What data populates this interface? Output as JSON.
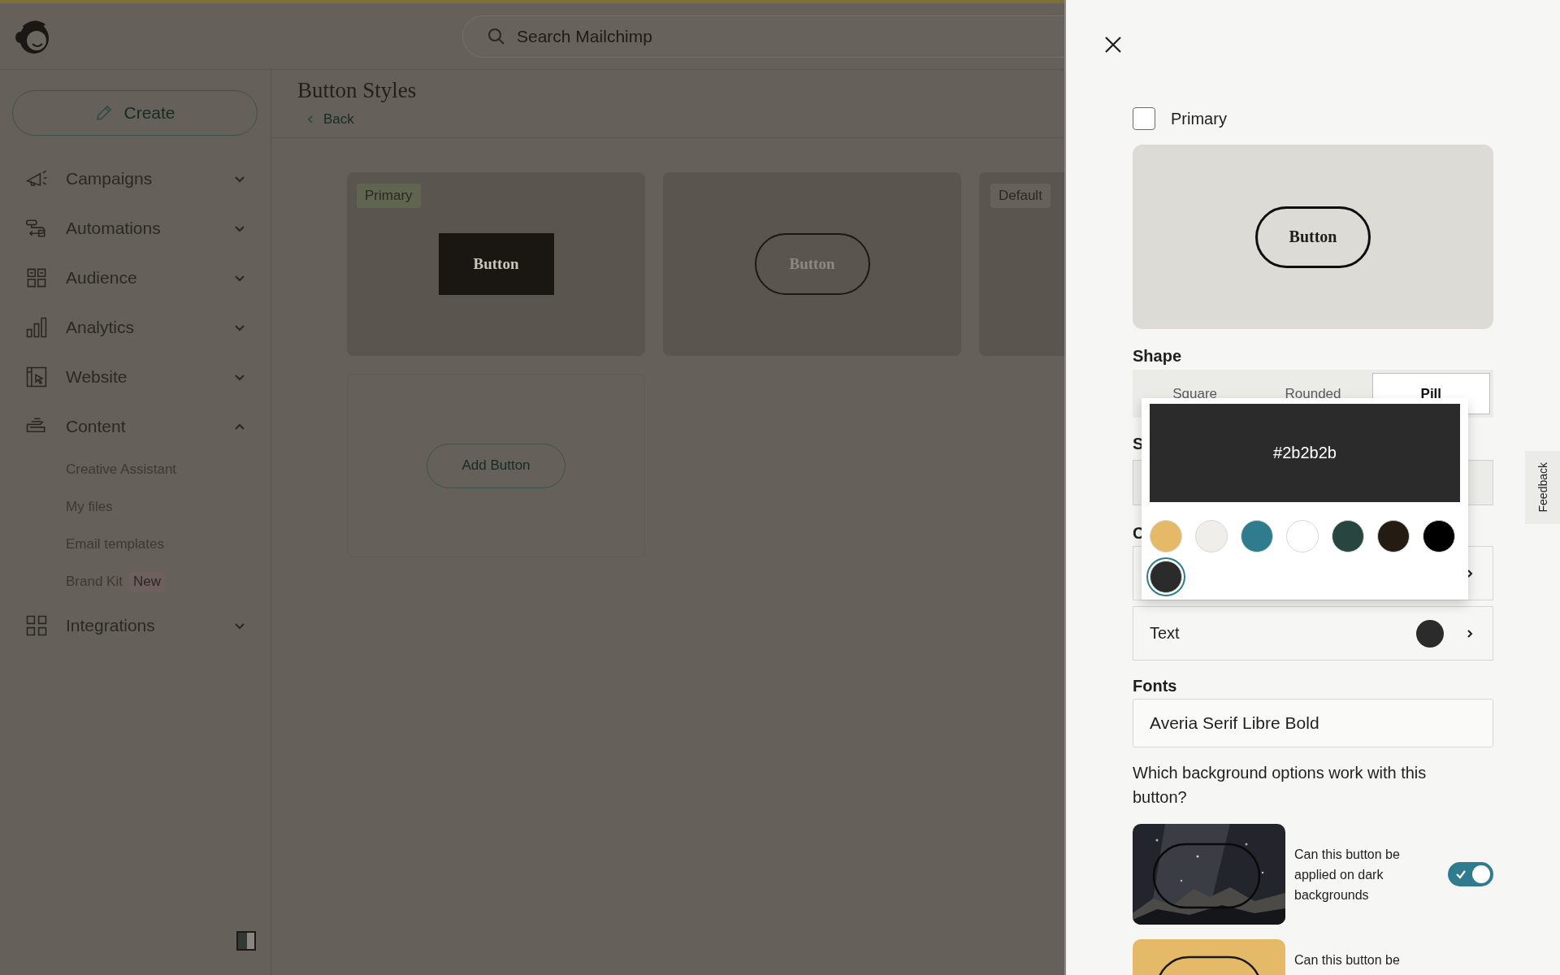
{
  "header": {
    "search": {
      "placeholder": "Search Mailchimp"
    }
  },
  "sidebar": {
    "create_button": "Create",
    "items": [
      {
        "label": "Campaigns",
        "expanded": false
      },
      {
        "label": "Automations",
        "expanded": false
      },
      {
        "label": "Audience",
        "expanded": false
      },
      {
        "label": "Analytics",
        "expanded": false
      },
      {
        "label": "Website",
        "expanded": false
      },
      {
        "label": "Content",
        "expanded": true,
        "children": [
          {
            "label": "Creative Assistant"
          },
          {
            "label": "My files"
          },
          {
            "label": "Email templates"
          },
          {
            "label": "Brand Kit",
            "badge": "New"
          }
        ]
      },
      {
        "label": "Integrations",
        "expanded": false
      }
    ]
  },
  "page": {
    "title": "Button Styles",
    "back": "Back",
    "cards": [
      {
        "tag": "Primary",
        "kind": "square",
        "label": "Button"
      },
      {
        "kind": "pill",
        "label": "Button"
      },
      {
        "tag": "Default"
      }
    ],
    "add_button": "Add Button"
  },
  "panel": {
    "primary": {
      "label": "Primary",
      "checked": false
    },
    "preview": {
      "label": "Button"
    },
    "shape": {
      "label": "Shape",
      "options": [
        {
          "label": "Square",
          "selected": false
        },
        {
          "label": "Rounded",
          "selected": false
        },
        {
          "label": "Pill",
          "selected": true
        }
      ]
    },
    "style": {
      "label": "S"
    },
    "colors": {
      "label": "C",
      "rows": [
        {
          "label": "Text",
          "color": "#2b2b2b"
        }
      ]
    },
    "picker": {
      "value": "#2b2b2b",
      "swatches": [
        {
          "color": "#e4b968",
          "selected": false
        },
        {
          "color": "#efeeea",
          "selected": false
        },
        {
          "color": "#2f7c8f",
          "selected": false
        },
        {
          "color": "#ffffff",
          "selected": false
        },
        {
          "color": "#27463f",
          "selected": false
        },
        {
          "color": "#241c13",
          "selected": false
        },
        {
          "color": "#000000",
          "selected": false
        },
        {
          "color": "#2b2b2b",
          "selected": true
        }
      ]
    },
    "fonts": {
      "label": "Fonts",
      "value": "Averia Serif Libre Bold"
    },
    "backgrounds": {
      "question": "Which background options work with this button?",
      "options": [
        {
          "kind": "dark",
          "text": "Can this button be applied on dark backgrounds",
          "on": true
        },
        {
          "kind": "light",
          "text": "Can this button be"
        }
      ]
    }
  },
  "feedback": "Feedback"
}
